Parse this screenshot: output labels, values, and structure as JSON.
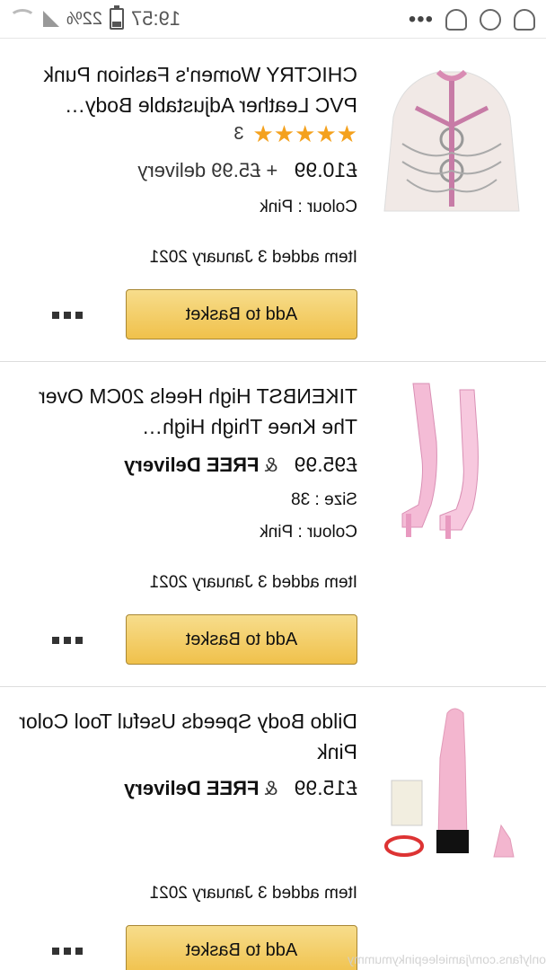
{
  "status_bar": {
    "time": "19:57",
    "battery": "22%"
  },
  "items": [
    {
      "title": "CHICTRY Women's Fashion Punk PVC Leather Adjustable Body…",
      "rating_count": "3",
      "price": "£10.99",
      "delivery": "+ £5.99 delivery",
      "attributes": [
        "Colour : Pink"
      ],
      "added": "Item added 3 January 2021",
      "button": "Add to Basket"
    },
    {
      "title": "TIKENBST High Heels 20CM Over The Knee Thigh High…",
      "price": "£95.99",
      "delivery_prefix": "&",
      "delivery": "FREE Delivery",
      "attributes": [
        "Size : 38",
        "Colour : Pink"
      ],
      "added": "Item added 3 January 2021",
      "button": "Add to Basket"
    },
    {
      "title": "Dildo Body Speeds Useful Tool Color Pink",
      "price": "£15.99",
      "delivery_prefix": "&",
      "delivery": "FREE Delivery",
      "attributes": [],
      "added": "Item added 3 January 2021",
      "button": "Add to Basket"
    }
  ],
  "watermark": "onlyfans.com/jamieleepinkymummy",
  "colors": {
    "button": "#f0c14b",
    "star": "#f4a11d"
  }
}
